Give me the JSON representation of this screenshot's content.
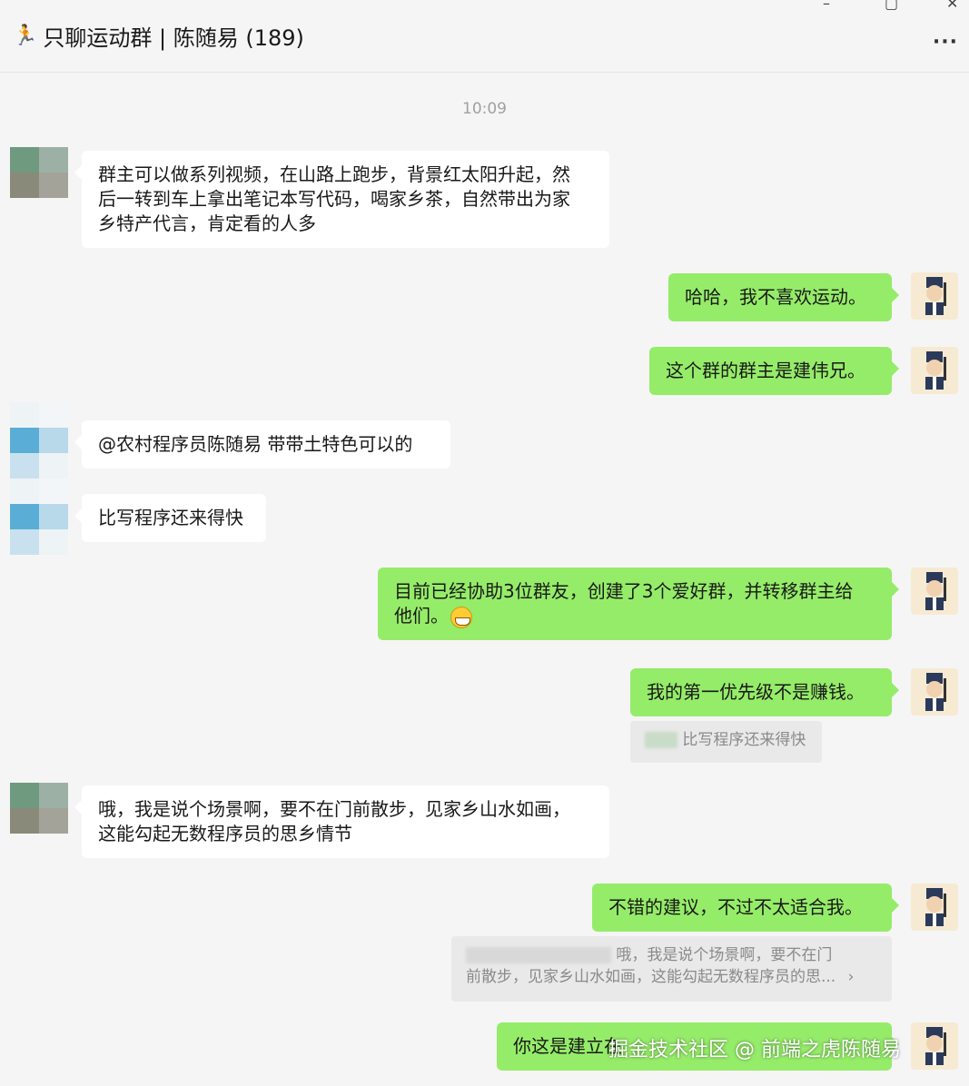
{
  "window": {
    "title_emoji": "🏃",
    "title": "只聊运动群 | 陈随易 (189)",
    "minimize": "–",
    "maximize": "▢",
    "close": "✕",
    "more": "···"
  },
  "timestamp": "10:09",
  "messages": [
    {
      "side": "left",
      "lines": [
        "群主可以做系列视频，在山路上跑步，背景红太阳升起，然",
        "后一转到车上拿出笔记本写代码，喝家乡茶，自然带出为家",
        "乡特产代言，肯定看的人多"
      ]
    },
    {
      "side": "right",
      "text": "哈哈，我不喜欢运动。"
    },
    {
      "side": "right",
      "text": "这个群的群主是建伟兄。"
    },
    {
      "side": "left",
      "text": "@农村程序员陈随易  带带土特色可以的"
    },
    {
      "side": "left",
      "text": "比写程序还来得快"
    },
    {
      "side": "right",
      "lines": [
        "目前已经协助3位群友，创建了3个爱好群，并转移群主给",
        "他们。"
      ]
    },
    {
      "side": "right",
      "text": "我的第一优先级不是赚钱。"
    },
    {
      "side": "quote",
      "text": "比写程序还来得快"
    },
    {
      "side": "left",
      "lines": [
        "哦，我是说个场景啊，要不在门前散步，见家乡山水如画，",
        "这能勾起无数程序员的思乡情节"
      ]
    },
    {
      "side": "right",
      "text": "不错的建议，不过不太适合我。"
    },
    {
      "side": "quote",
      "lines": [
        "哦，我是说个场景啊，要不在门",
        "前散步，见家乡山水如画，这能勾起无数程序员的思..."
      ],
      "chevron": "›"
    },
    {
      "side": "right",
      "text": "你这是建立在"
    }
  ],
  "watermark": "掘金技术社区 @ 前端之虎陈随易",
  "colors": {
    "background": "#f5f5f5",
    "bubble_self": "#95ec69",
    "bubble_other": "#ffffff",
    "quote_bg": "#e9e9e9"
  }
}
